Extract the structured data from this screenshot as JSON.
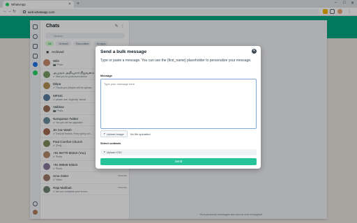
{
  "browser": {
    "tab_title": "WhatsApp",
    "url": "web.whatsapp.com"
  },
  "chats": {
    "title": "Chats",
    "search_placeholder": "Search",
    "filters": [
      "All",
      "Unread",
      "Favourites",
      "Groups"
    ],
    "archived_label": "Archived",
    "items": [
      {
        "name": "Wife",
        "msg": "📷 Photo",
        "time": "",
        "color": "#c98b6b"
      },
      {
        "name": "அமுதம் அறிவுசார் நிறுவனம்",
        "msg": "✔ Wait you're pudhusa irukkum",
        "time": "",
        "color": "#7a9e63"
      },
      {
        "name": "Dilipa",
        "msg": "✔ Thank you (Maybe will be upload...",
        "time": "",
        "color": "#b39157"
      },
      {
        "name": "MPSIC",
        "msg": "✔ please see 'Anybody' above",
        "time": "",
        "color": "#5b7fa3"
      },
      {
        "name": "Vaibhav",
        "msg": "📷 Photo",
        "time": "",
        "color": "#9c6f5a"
      },
      {
        "name": "Narayanan Twitter",
        "msg": "✔ Yes yes will be upgraded",
        "time": "",
        "color": "#6b8f9e"
      },
      {
        "name": "JD Car Wash",
        "msg": "✔ [Yes] sir thanks. Keep going our...",
        "time": "",
        "color": "#a36b4f"
      },
      {
        "name": "Paul Comfort Church",
        "msg": "✔ [Text] ...",
        "time": "",
        "color": "#7e8c5c"
      },
      {
        "name": "+91 96770 60310 (You)",
        "msg": "✔ Photo",
        "time": "Yesterday",
        "color": "#b48a6a"
      },
      {
        "name": "+91 98849 63523",
        "msg": "✔ Photo",
        "time": "Yesterday",
        "color": "#8a7a9e"
      },
      {
        "name": "Uma Sister",
        "msg": "✔ Video",
        "time": "Yesterday",
        "color": "#9e7a6b"
      },
      {
        "name": "Raja Mahbub",
        "msg": "✔ Are you complete your forum...",
        "time": "Yesterday",
        "color": "#6f8a72"
      }
    ]
  },
  "main": {
    "e2e_notice": "Your personal messages are end-to-end encrypted"
  },
  "modal": {
    "title": "Send a bulk message",
    "description": "Type or paste a message. You can use the {first_name} placeholder to personalize your message.",
    "message_label": "Message",
    "message_placeholder": "Type your message here",
    "upload_image_label": "Upload Image",
    "no_file_text": "No file uploaded",
    "select_contacts_label": "Select contacts",
    "upload_csv_label": "Upload CSV",
    "send_label": "Send"
  },
  "colors": {
    "whatsapp_green": "#00a884",
    "send_button": "#27c499"
  }
}
